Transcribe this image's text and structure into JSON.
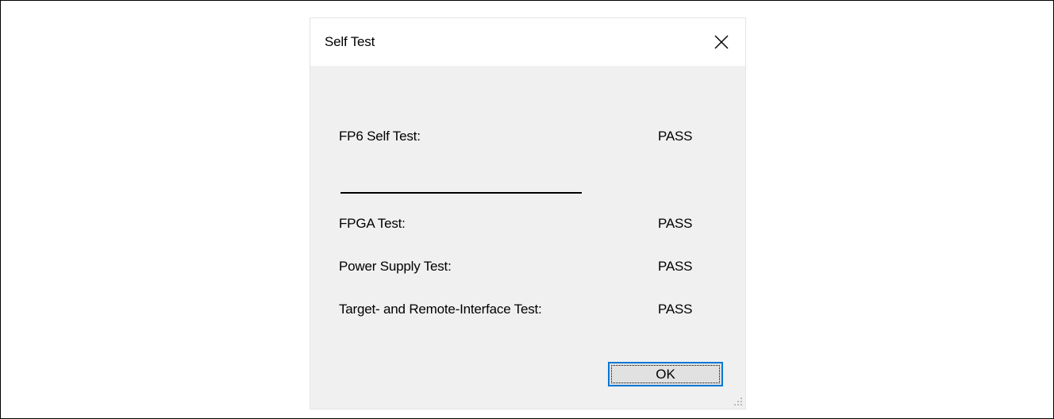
{
  "dialog": {
    "title": "Self Test",
    "close_icon": "close-icon",
    "rows": [
      {
        "label": "FP6 Self Test:",
        "value": "PASS"
      },
      {
        "label": "FPGA Test:",
        "value": "PASS"
      },
      {
        "label": "Power Supply Test:",
        "value": "PASS"
      },
      {
        "label": "Target- and Remote-Interface Test:",
        "value": "PASS"
      }
    ],
    "ok_label": "OK",
    "grip_icon": "resize-grip-icon"
  },
  "colors": {
    "dialog_bg": "#f0f0f0",
    "titlebar_bg": "#ffffff",
    "focus_accent": "#0078d7"
  }
}
